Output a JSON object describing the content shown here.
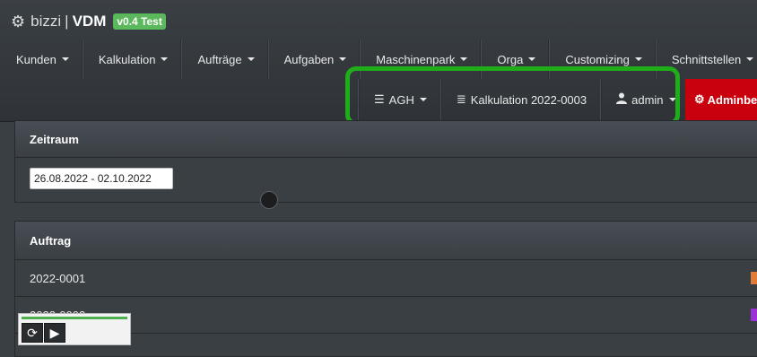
{
  "brand": {
    "icon": "gear-icon",
    "name": "bizzi",
    "app": "VDM",
    "badge": "v0.4 Test"
  },
  "nav": {
    "items": [
      {
        "label": "Kunden"
      },
      {
        "label": "Kalkulation"
      },
      {
        "label": "Aufträge"
      },
      {
        "label": "Aufgaben"
      },
      {
        "label": "Maschinenpark"
      },
      {
        "label": "Orga"
      },
      {
        "label": "Customizing"
      },
      {
        "label": "Schnittstellen"
      }
    ]
  },
  "user_nav": {
    "company": {
      "label": "AGH",
      "icon": "list-icon"
    },
    "calc": {
      "label": "Kalkulation 2022-0003",
      "icon": "align-left-icon"
    },
    "user": {
      "label": "admin",
      "icon": "user-icon"
    },
    "admin": {
      "label": "Adminbere",
      "icon": "gear-icon",
      "color": "#c9000d"
    }
  },
  "zeitraum": {
    "title": "Zeitraum",
    "value": "26.08.2022 - 02.10.2022"
  },
  "auftrag": {
    "title": "Auftrag",
    "rows": [
      {
        "id": "2022-0001",
        "color": "#e07b39"
      },
      {
        "id": "2022-0002",
        "color": "#9b30d9"
      }
    ]
  },
  "highlight_color": "#1fae1a",
  "player": {
    "progress": 1.0
  }
}
